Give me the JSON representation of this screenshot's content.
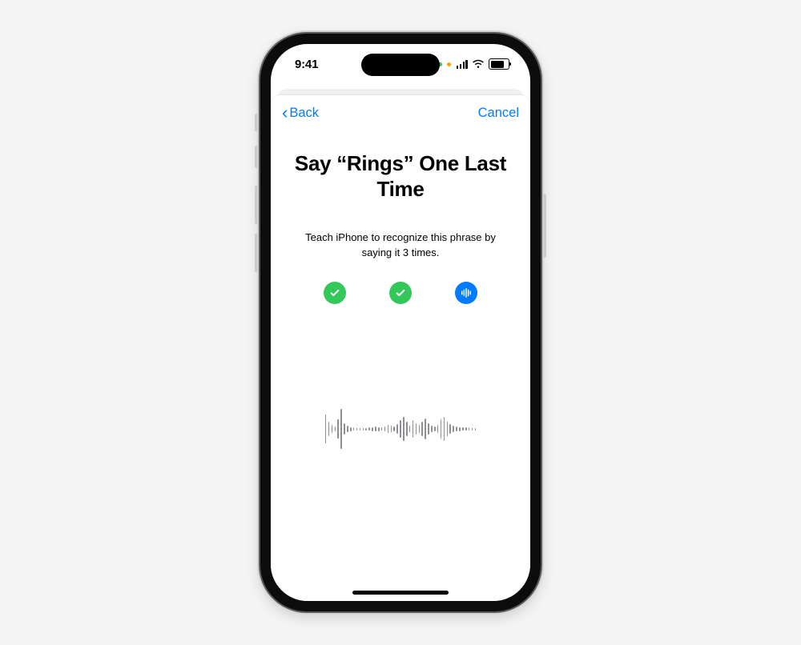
{
  "statusbar": {
    "time": "9:41"
  },
  "nav": {
    "back_label": "Back",
    "cancel_label": "Cancel"
  },
  "screen": {
    "title": "Say “Rings” One Last Time",
    "subtitle": "Teach iPhone to recognize this phrase by saying it 3 times."
  },
  "progress": {
    "steps": [
      {
        "state": "done"
      },
      {
        "state": "done"
      },
      {
        "state": "active"
      }
    ]
  },
  "colors": {
    "accent_blue": "#007aff",
    "success_green": "#34c759"
  },
  "waveform": {
    "bars": [
      36,
      18,
      10,
      6,
      24,
      50,
      14,
      8,
      5,
      4,
      3,
      3,
      3,
      3,
      4,
      5,
      6,
      5,
      4,
      6,
      10,
      8,
      6,
      12,
      22,
      30,
      18,
      8,
      22,
      14,
      10,
      18,
      26,
      14,
      8,
      6,
      10,
      24,
      30,
      18,
      12,
      8,
      6,
      5,
      4,
      4,
      4,
      3,
      3
    ]
  }
}
